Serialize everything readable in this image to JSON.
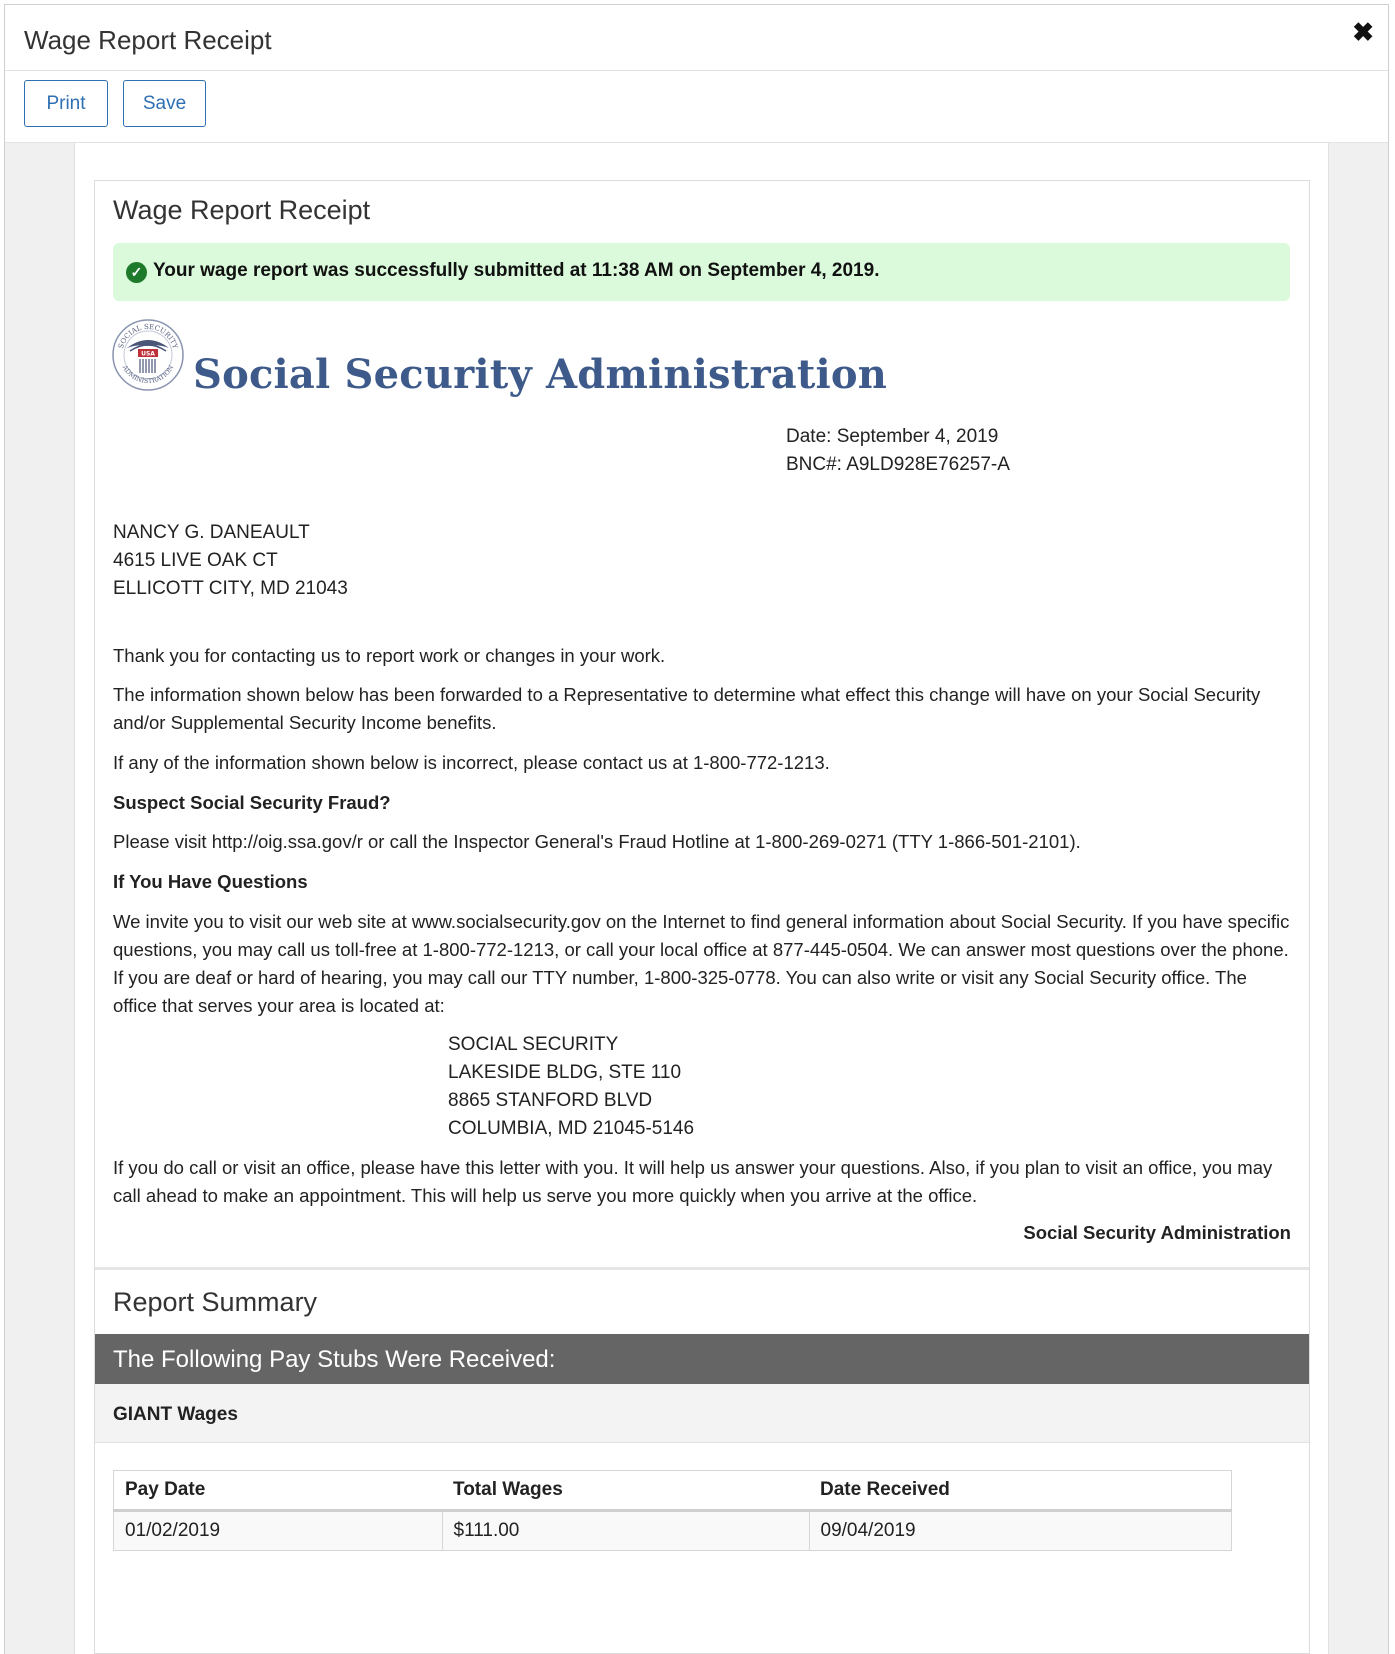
{
  "modal": {
    "title": "Wage Report Receipt",
    "close_icon": "✖",
    "print_label": "Print",
    "save_label": "Save"
  },
  "receipt": {
    "title": "Wage Report Receipt",
    "alert_text": "Your wage report was successfully submitted at 11:38 AM on September 4, 2019.",
    "agency_name": "Social Security Administration",
    "seal_text_top": "SOCIAL SECURITY",
    "seal_text_mid": "USA",
    "seal_text_bottom": "ADMINISTRATION",
    "date_line": "Date: September 4, 2019",
    "bnc_line": "BNC#: A9LD928E76257-A",
    "recipient": {
      "name": "NANCY G. DANEAULT",
      "street": "4615 LIVE OAK CT",
      "city": "ELLICOTT CITY, MD 21043"
    },
    "para_thanks": "Thank you for contacting us to report work or changes in your work.",
    "para_forwarded": "The information shown below has been forwarded to a Representative to determine what effect this change will have on your Social Security and/or Supplemental Security Income benefits.",
    "para_incorrect": "If any of the information shown below is incorrect, please contact us at 1-800-772-1213.",
    "fraud_heading": "Suspect Social Security Fraud?",
    "fraud_text": "Please visit http://oig.ssa.gov/r or call the Inspector General's Fraud Hotline at 1-800-269-0271 (TTY 1-866-501-2101).",
    "questions_heading": "If You Have Questions",
    "questions_text": "We invite you to visit our web site at www.socialsecurity.gov on the Internet to find general information about Social Security. If you have specific questions, you may call us toll-free at 1-800-772-1213, or call your local office at 877-445-0504. We can answer most questions over the phone. If you are deaf or hard of hearing, you may call our TTY number, 1-800-325-0778. You can also write or visit any Social Security office. The office that serves your area is located at:",
    "office": {
      "line1": "SOCIAL SECURITY",
      "line2": "LAKESIDE BLDG, STE 110",
      "line3": "8865 STANFORD BLVD",
      "line4": "COLUMBIA, MD 21045-5146"
    },
    "para_visit": "If you do call or visit an office, please have this letter with you. It will help us answer your questions. Also, if you plan to visit an office, you may call ahead to make an appointment. This will help us serve you more quickly when you arrive at the office.",
    "signature": "Social Security Administration"
  },
  "summary": {
    "title": "Report Summary",
    "stubs_heading": "The Following Pay Stubs Were Received:",
    "employer": "GIANT Wages",
    "columns": [
      "Pay Date",
      "Total Wages",
      "Date Received"
    ],
    "rows": [
      [
        "01/02/2019",
        "$111.00",
        "09/04/2019"
      ]
    ]
  },
  "colors": {
    "accent": "#2f6fb3",
    "success_bg": "#dbfadb",
    "success_icon": "#1d7a2a",
    "agency_blue": "#3d5a8a",
    "header_bar": "#656565"
  }
}
